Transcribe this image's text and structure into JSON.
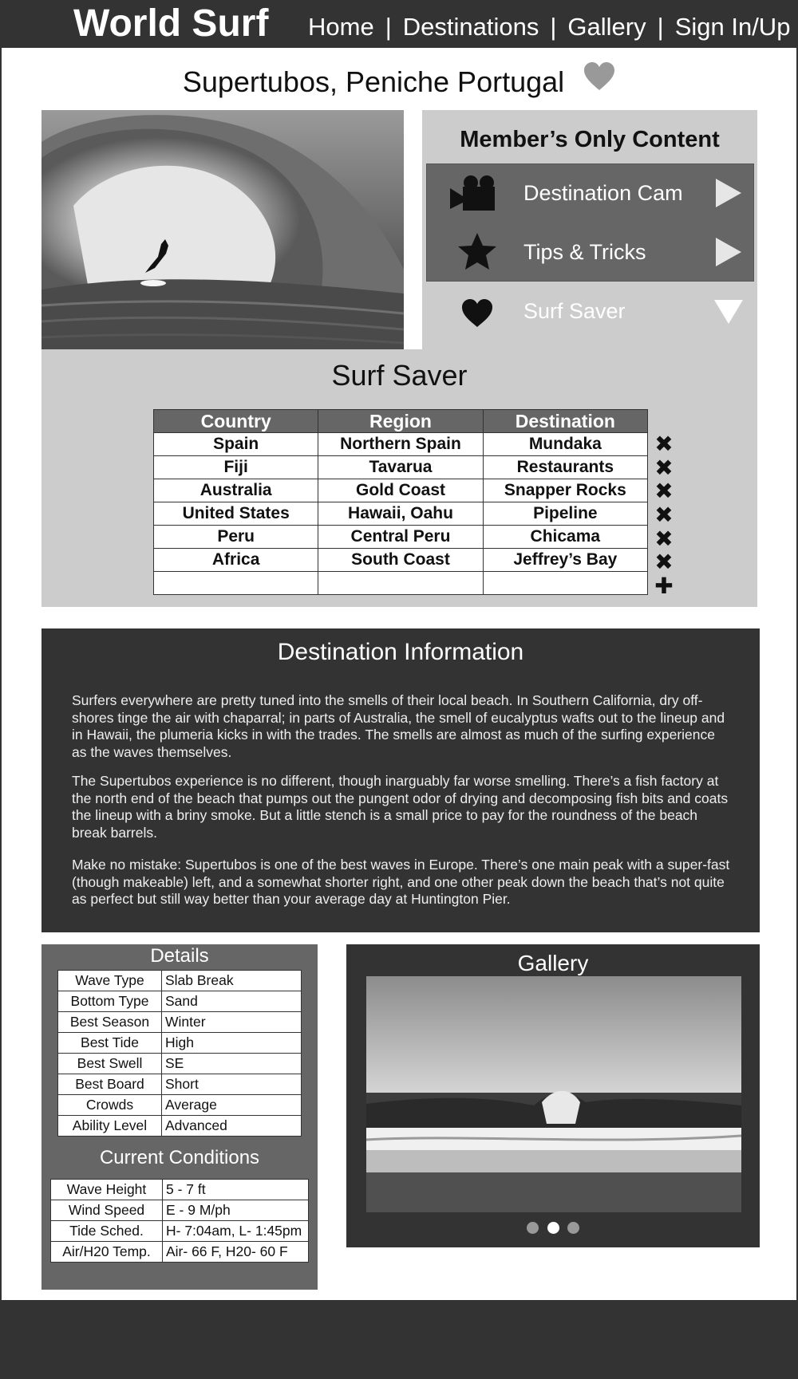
{
  "header": {
    "brand": "World Surf",
    "nav": [
      "Home",
      "Destinations",
      "Gallery",
      "Sign In/Up"
    ],
    "separator": "|"
  },
  "page_title": "Supertubos, Peniche Portugal",
  "members": {
    "title": "Member’s Only Content",
    "items": [
      {
        "label": "Destination Cam",
        "icon": "video-camera-icon",
        "arrow": "play-arrow-icon"
      },
      {
        "label": "Tips & Tricks",
        "icon": "star-icon",
        "arrow": "play-arrow-icon"
      },
      {
        "label": "Surf Saver",
        "icon": "heart-icon",
        "arrow": "down-triangle-icon"
      }
    ]
  },
  "surf_saver": {
    "title": "Surf Saver",
    "columns": [
      "Country",
      "Region",
      "Destination"
    ],
    "rows": [
      [
        "Spain",
        "Northern Spain",
        "Mundaka"
      ],
      [
        "Fiji",
        "Tavarua",
        "Restaurants"
      ],
      [
        "Australia",
        "Gold Coast",
        "Snapper Rocks"
      ],
      [
        "United States",
        "Hawaii, Oahu",
        "Pipeline"
      ],
      [
        "Peru",
        "Central Peru",
        "Chicama"
      ],
      [
        "Africa",
        "South Coast",
        "Jeffrey’s Bay"
      ],
      [
        "",
        "",
        ""
      ]
    ],
    "remove_symbol": "✖",
    "add_symbol": "✚"
  },
  "destination_info": {
    "title": "Destination Information",
    "paragraphs": [
      "Surfers everywhere are pretty tuned into the smells of their local beach. In Southern California, dry off-shores tinge the air with chaparral; in parts of Australia, the smell of eucalyptus wafts out to the lineup and in Hawaii, the plumeria kicks in with the trades. The smells are almost as much of the surfing experience as the waves themselves.",
      "The Supertubos experience is no different, though inarguably far worse smelling. There’s a fish factory at the north end of the beach that pumps out the pungent odor of drying and decomposing fish bits and coats the lineup with a briny smoke. But a little stench is a small price to pay for the roundness of the beach break barrels.",
      "Make no mistake: Supertubos is one of the best waves in Europe. There’s one main peak with a super-fast (though makeable) left, and a somewhat shorter right, and one other peak down the beach that’s not quite as perfect but still way better than your average day at Huntington Pier."
    ]
  },
  "details": {
    "title": "Details",
    "rows": [
      [
        "Wave Type",
        "Slab Break"
      ],
      [
        "Bottom Type",
        "Sand"
      ],
      [
        "Best Season",
        "Winter"
      ],
      [
        "Best Tide",
        "High"
      ],
      [
        "Best Swell",
        "SE"
      ],
      [
        "Best Board",
        "Short"
      ],
      [
        "Crowds",
        "Average"
      ],
      [
        "Ability Level",
        "Advanced"
      ]
    ]
  },
  "conditions": {
    "title": "Current Conditions",
    "rows": [
      [
        "Wave Height",
        "5 - 7 ft"
      ],
      [
        "Wind Speed",
        "E - 9 M/ph"
      ],
      [
        "Tide Sched.",
        "H- 7:04am, L- 1:45pm"
      ],
      [
        "Air/H20 Temp.",
        "Air- 66 F,  H20- 60 F"
      ]
    ]
  },
  "gallery": {
    "title": "Gallery",
    "slide_count": 3,
    "active_slide": 2
  },
  "colors": {
    "dark": "#333333",
    "medium": "#666666",
    "light": "#cccccc",
    "white": "#ffffff"
  }
}
